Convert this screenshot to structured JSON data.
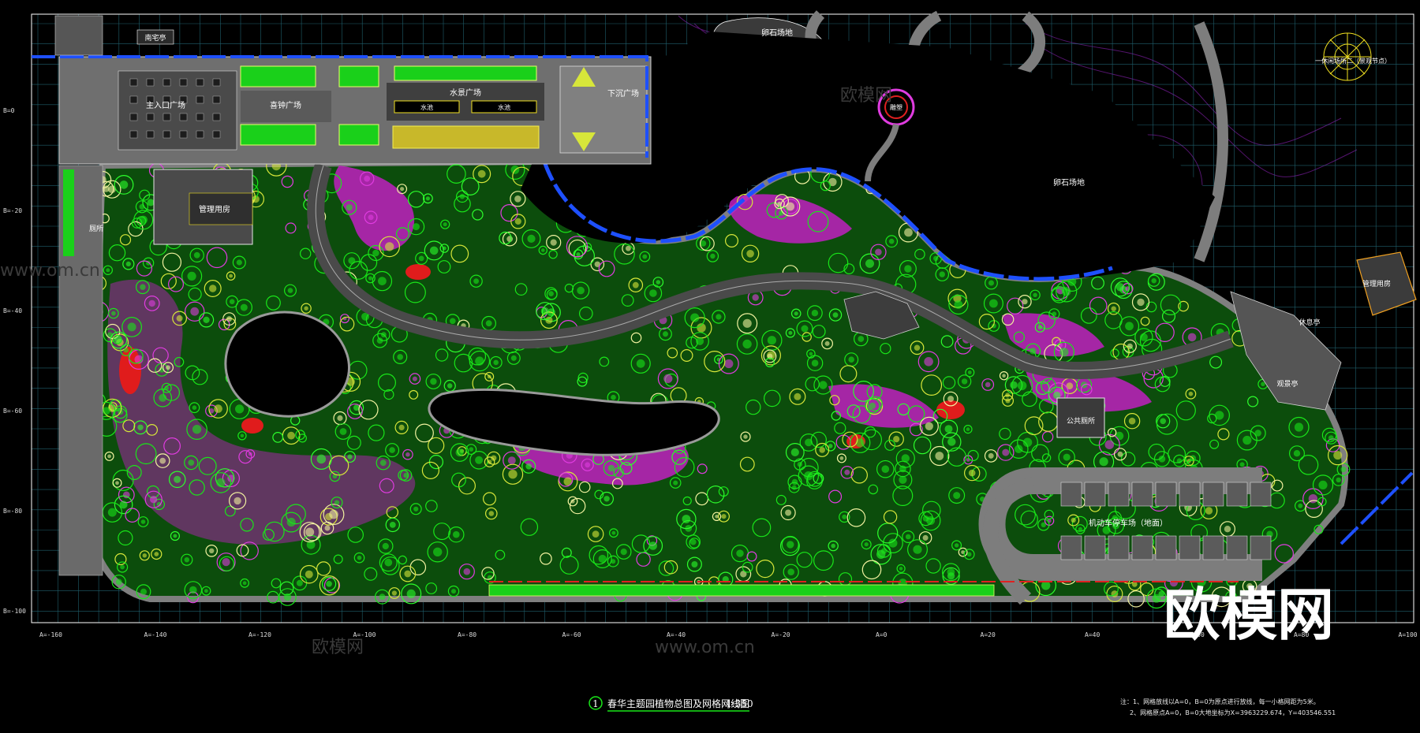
{
  "palette": {
    "background": "#000000",
    "grid": "#2f8fa0",
    "boundary": "#ffffff",
    "paving": "#8a8a8a",
    "tree": "#19e619",
    "shrub_yellow": "#d7e63a",
    "flower_magenta": "#e03ce0",
    "flower_red": "#e02020",
    "water_edge": "#1e50ff",
    "contour": "#7a1f9a"
  },
  "areas": {
    "tea_pavilion": "南宅亭",
    "main_entrance_plaza": "主入口广场",
    "bell_plaza": "喜钟广场",
    "water_plaza": "水景广场",
    "pool_left": "水池",
    "pool_right": "水池",
    "sunken_plaza": "下沉广场",
    "management_room": "管理用房",
    "toilet_left": "厕所",
    "rock_sand_top": "卵石场地",
    "ring_node": "雕塑",
    "rock_sand_right": "卵石场地",
    "pavilion_top_right": "一休闲场所二（景观节点）",
    "management_right": "管理用房",
    "rest_pavilion": "休息亭",
    "viewing_pavilion": "观景亭",
    "public_toilet": "公共厕所",
    "parking": "机动车停车场（地面）"
  },
  "axes": {
    "x_labels": [
      "A=-160",
      "A=-140",
      "A=-120",
      "A=-100",
      "A=-80",
      "A=-60",
      "A=-40",
      "A=-20",
      "A=0",
      "A=20",
      "A=40",
      "A=60",
      "A=80",
      "A=100"
    ],
    "y_labels": [
      "B=0",
      "B=-20",
      "B=-40",
      "B=-60",
      "B=-80",
      "B=-100"
    ]
  },
  "title_block": {
    "number": "1",
    "title": "春华主题园植物总图及网格网线图",
    "scale": "1:350"
  },
  "notes": [
    "注：1、网格放线以A=0，B=0为原点进行放线，每一小格网距为5米。",
    "2、网格原点A=0，B=0大地坐标为X=3963229.674，Y=403546.551"
  ],
  "watermarks": {
    "site_url": "www.om.cn",
    "site_name": "欧模网"
  }
}
